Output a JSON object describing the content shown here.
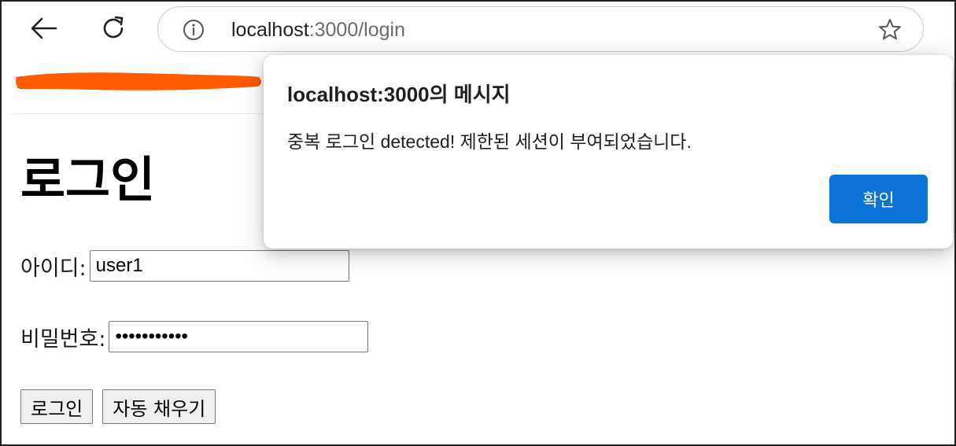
{
  "browser": {
    "url_host": "localhost",
    "url_rest": ":3000/login",
    "icons": {
      "back": "arrow-left-icon",
      "reload": "reload-icon",
      "site_info": "info-icon",
      "bookmark": "star-icon"
    }
  },
  "page": {
    "title": "로그인",
    "id_label": "아이디:",
    "id_value": "user1",
    "pw_label": "비밀번호:",
    "pw_value": "•••••••••••",
    "login_button": "로그인",
    "autofill_button": "자동 채우기"
  },
  "dialog": {
    "title": "localhost:3000의 메시지",
    "message": "중복 로그인 detected! 제한된 세션이 부여되었습니다.",
    "ok_label": "확인",
    "ok_color": "#0b74d6"
  },
  "colors": {
    "redaction": "#ff5a00"
  }
}
